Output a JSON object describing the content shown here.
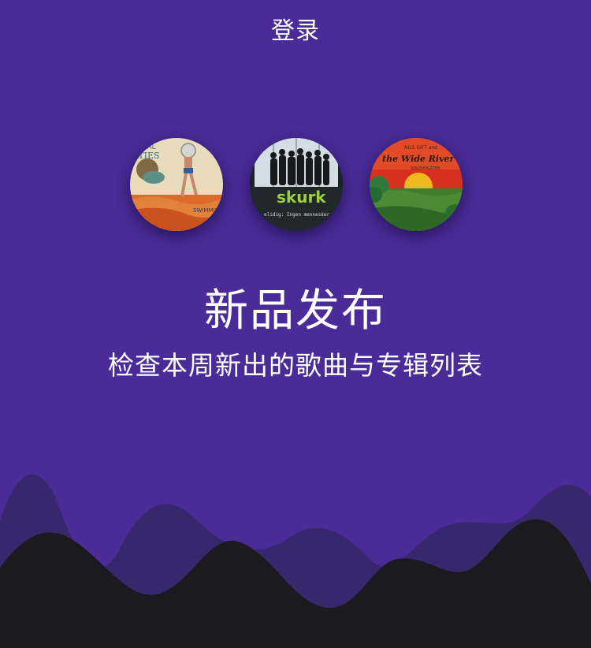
{
  "header": {
    "login_label": "登录"
  },
  "featured_albums": [
    {
      "title_lines": [
        "ITAL",
        "ITIES"
      ],
      "cover_text": "SWIMMIN",
      "palette": [
        "#e7d9b9",
        "#d9652a",
        "#6f9c8f"
      ]
    },
    {
      "title": "skurk",
      "tagline": "elidig: Ingen mennesker",
      "palette": [
        "#1f2529",
        "#9ed03d",
        "#cfd9e0"
      ]
    },
    {
      "artist_line": "NILS GIFT and",
      "title": "the Wide River",
      "subtitle": "SOLOVOGSTER",
      "palette": [
        "#d92d21",
        "#f2b71d",
        "#3c7d2c"
      ]
    }
  ],
  "hero": {
    "title": "新品发布",
    "subtitle": "检查本周新出的歌曲与专辑列表"
  },
  "colors": {
    "background": "#4a2b97",
    "wave_dark": "#1b1b1f",
    "wave_shadow": "#36276a",
    "text": "#ffffff"
  }
}
